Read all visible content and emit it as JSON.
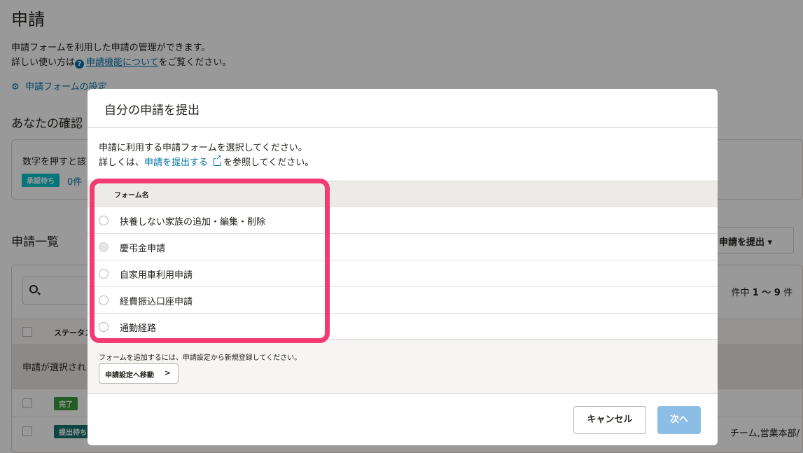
{
  "page": {
    "title": "申請",
    "desc_line1": "申請フォームを利用した申請の管理ができます。",
    "desc_line2_prefix": "詳しい使い方は",
    "desc_line2_link": "申請機能について",
    "desc_line2_suffix": "をご覧ください。",
    "settings_link": "申請フォームの設定",
    "confirm_heading": "あなたの確認",
    "confirm_hint": "数字を押すと該",
    "confirm_badge": "承認待ち",
    "confirm_count": "0件",
    "list_heading": "申請一覧",
    "submit_button": "申請を提出",
    "pager_prefix": "件中",
    "pager_range": "1 〜 9",
    "pager_suffix": "件",
    "list_col_status": "ステータス",
    "select_banner": "申請が選択され",
    "rows": [
      {
        "badge": "完了",
        "tail": ""
      },
      {
        "badge": "提出待ち",
        "tail": "チーム,営業本部/"
      }
    ]
  },
  "modal": {
    "title": "自分の申請を提出",
    "intro_line1": "申請に利用する申請フォームを選択してください。",
    "intro_line2_prefix": "詳しくは、",
    "intro_line2_link": "申請を提出する",
    "intro_line2_suffix": "を参照してください。",
    "column_header": "フォーム名",
    "forms": [
      {
        "label": "扶養しない家族の追加・編集・削除",
        "disabled": false
      },
      {
        "label": "慶弔金申請",
        "disabled": true
      },
      {
        "label": "自家用車利用申請",
        "disabled": false
      },
      {
        "label": "経費振込口座申請",
        "disabled": false
      },
      {
        "label": "通勤経路",
        "disabled": false
      }
    ],
    "footer_note": "フォームを追加するには、申請設定から新規登録してください。",
    "goto_settings": "申請設定へ移動",
    "cancel": "キャンセル",
    "next": "次へ"
  },
  "colors": {
    "link": "#0073a8",
    "highlight": "#f23a73",
    "next_disabled": "#8bbde6",
    "badge_pending": "#00c4cc",
    "badge_done": "#3b9b3b",
    "badge_submit": "#15766f"
  }
}
